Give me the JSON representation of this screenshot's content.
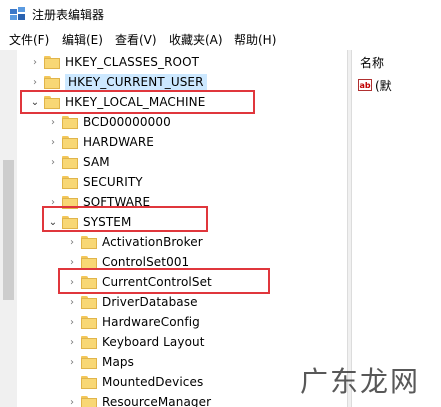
{
  "window": {
    "title": "注册表编辑器"
  },
  "menu": [
    "文件(F)",
    "编辑(E)",
    "查看(V)",
    "收藏夹(A)",
    "帮助(H)"
  ],
  "tree": {
    "top_items": [
      {
        "label": "HKEY_CLASSES_ROOT",
        "expander": "›"
      },
      {
        "label": "HKEY_CURRENT_USER",
        "expander": "›"
      },
      {
        "label": "HKEY_LOCAL_MACHINE",
        "expander": "⌄"
      }
    ],
    "hklm_children": [
      {
        "label": "BCD00000000",
        "expander": "›"
      },
      {
        "label": "HARDWARE",
        "expander": "›"
      },
      {
        "label": "SAM",
        "expander": "›"
      },
      {
        "label": "SECURITY",
        "expander": ""
      },
      {
        "label": "SOFTWARE",
        "expander": "›"
      },
      {
        "label": "SYSTEM",
        "expander": "⌄"
      }
    ],
    "system_children": [
      {
        "label": "ActivationBroker",
        "expander": "›"
      },
      {
        "label": "ControlSet001",
        "expander": "›"
      },
      {
        "label": "CurrentControlSet",
        "expander": "›"
      },
      {
        "label": "DriverDatabase",
        "expander": "›"
      },
      {
        "label": "HardwareConfig",
        "expander": "›"
      },
      {
        "label": "Keyboard Layout",
        "expander": "›"
      },
      {
        "label": "Maps",
        "expander": "›"
      },
      {
        "label": "MountedDevices",
        "expander": ""
      },
      {
        "label": "ResourceManager",
        "expander": "›"
      }
    ]
  },
  "values_pane": {
    "column_name": "名称",
    "default_value": "(默"
  },
  "watermark": "广东龙网"
}
